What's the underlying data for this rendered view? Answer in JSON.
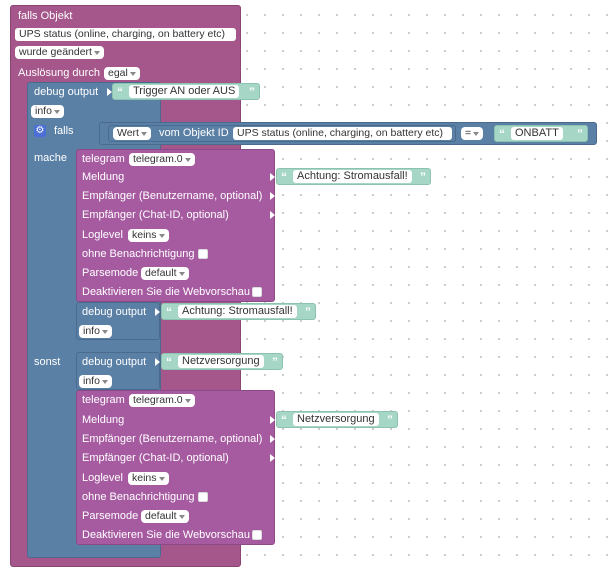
{
  "trigger": {
    "title": "falls Objekt",
    "object": "UPS status (online, charging, on battery etc)",
    "event": "wurde geändert",
    "ausloesung_label": "Auslösung durch",
    "ausloesung_value": "egal"
  },
  "debug_top": {
    "label": "debug output",
    "text": "Trigger AN oder AUS",
    "level": "info"
  },
  "condition": {
    "falls_label": "falls",
    "wert": "Wert",
    "vom_objekt": "vom Objekt ID",
    "object": "UPS status (online, charging, on battery etc)",
    "operator": "=",
    "value": "ONBATT"
  },
  "mache": {
    "label": "mache",
    "telegram": {
      "label": "telegram",
      "instance": "telegram.0",
      "meldung_label": "Meldung",
      "meldung_text": "Achtung: Stromausfall!",
      "empf_user": "Empfänger (Benutzername, optional)",
      "empf_chat": "Empfänger (Chat-ID, optional)",
      "loglevel_label": "Loglevel",
      "loglevel_value": "keins",
      "ohne": "ohne Benachrichtigung",
      "parsemode_label": "Parsemode",
      "parsemode_value": "default",
      "deaktivieren": "Deaktivieren Sie die Webvorschau"
    },
    "debug": {
      "label": "debug output",
      "text": "Achtung: Stromausfall!",
      "level": "info"
    }
  },
  "sonst": {
    "label": "sonst",
    "debug": {
      "label": "debug output",
      "text": "Netzversorgung",
      "level": "info"
    },
    "telegram": {
      "label": "telegram",
      "instance": "telegram.0",
      "meldung_label": "Meldung",
      "meldung_text": "Netzversorgung",
      "empf_user": "Empfänger (Benutzername, optional)",
      "empf_chat": "Empfänger (Chat-ID, optional)",
      "loglevel_label": "Loglevel",
      "loglevel_value": "keins",
      "ohne": "ohne Benachrichtigung",
      "parsemode_label": "Parsemode",
      "parsemode_value": "default",
      "deaktivieren": "Deaktivieren Sie die Webvorschau"
    }
  },
  "quote_glyph": "“",
  "quote_glyph_close": "”",
  "colors": {
    "trigger_block": "#a5568a",
    "logic_block": "#5b80a5",
    "telegram_block": "#a65ba1",
    "string_block": "#a5d6c6"
  }
}
